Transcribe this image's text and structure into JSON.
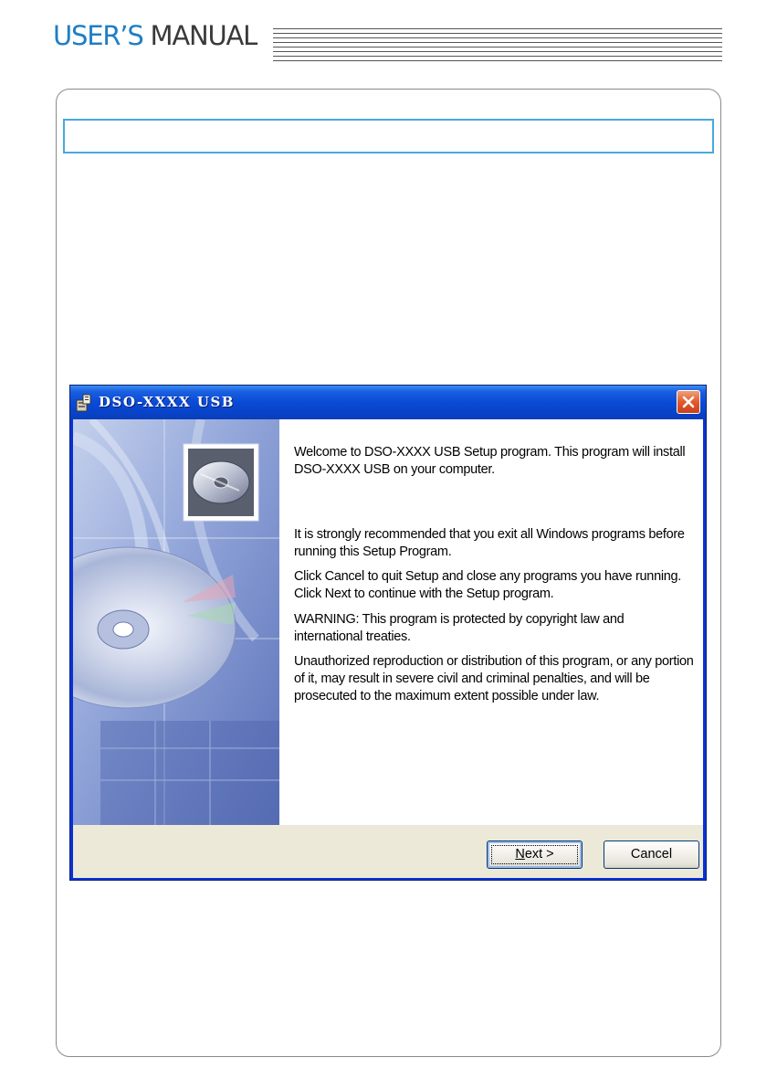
{
  "header": {
    "title_part1": "USER’S",
    "title_part2": "MANUAL"
  },
  "window": {
    "title": "DSO-XXXX USB",
    "icon": "setup-program-icon",
    "close_icon": "close-icon",
    "graphic_icon": "cd-disc-icon",
    "messages": [
      "Welcome to DSO-XXXX USB Setup program. This program will install DSO-XXXX USB on your computer.",
      "It is strongly recommended that you exit all Windows programs before running this Setup Program.",
      "Click Cancel to quit Setup and close any programs you have running.  Click Next to continue with the Setup program.",
      "WARNING: This program is protected by copyright law and international treaties.",
      "Unauthorized reproduction or distribution of this program, or any portion of it, may result in severe civil and criminal penalties, and will be prosecuted to the maximum extent possible under law."
    ],
    "buttons": {
      "next_first": "N",
      "next_rest": "ext >",
      "cancel": "Cancel"
    },
    "colors": {
      "titlebar": "#0a4ad6",
      "close": "#e25a2c",
      "section_border": "#48a9dc",
      "manual_blue": "#1f7ec4"
    }
  }
}
